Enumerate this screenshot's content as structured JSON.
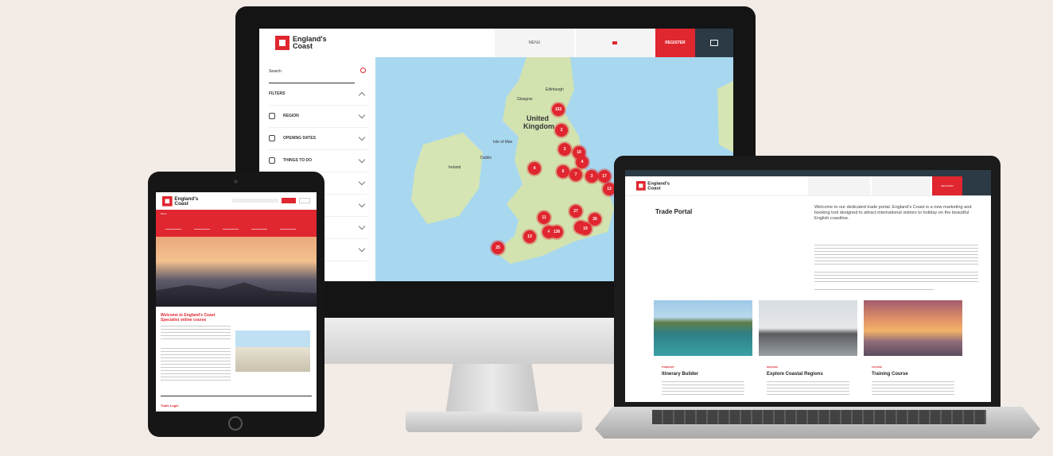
{
  "brand": {
    "name_line1": "England's",
    "name_line2": "Coast",
    "accent": "#e0262f",
    "dark": "#2b3a45"
  },
  "imac": {
    "menu_label": "MENU",
    "register_label": "REGISTER",
    "search_placeholder": "Search",
    "filters_label": "FILTERS",
    "filters": [
      {
        "label": "REGION",
        "icon": "user-icon"
      },
      {
        "label": "OPENING DATES",
        "icon": "calendar-icon"
      },
      {
        "label": "THINGS TO DO",
        "icon": "ticket-icon"
      }
    ],
    "map_labels": [
      "United",
      "Kingdom",
      "Ireland",
      "Glasgow",
      "Isle of Man",
      "Dublin",
      "Edinburgh"
    ],
    "pins": [
      "153",
      "2",
      "3",
      "4",
      "10",
      "6",
      "7",
      "3",
      "17",
      "4",
      "13",
      "27",
      "8",
      "11",
      "4",
      "13",
      "136",
      "26",
      "19",
      "25"
    ]
  },
  "tablet": {
    "nav_label": "Menu",
    "headline_line1": "Welcome to England's Coast",
    "headline_line2": "Specialist online course",
    "footer_link": "Trade Login"
  },
  "laptop": {
    "page_title": "Trade Portal",
    "intro": "Welcome to our dedicated trade portal. England's Coast is a new marketing and booking tool designed to attract international visitors to holiday on the beautiful English coastline.",
    "register_label": "REGISTER",
    "cards": [
      {
        "tag": "ITINERARY",
        "title": "Itinerary Builder"
      },
      {
        "tag": "REGIONS",
        "title": "Explore Coastal Regions"
      },
      {
        "tag": "COURSE",
        "title": "Training Course"
      }
    ]
  }
}
